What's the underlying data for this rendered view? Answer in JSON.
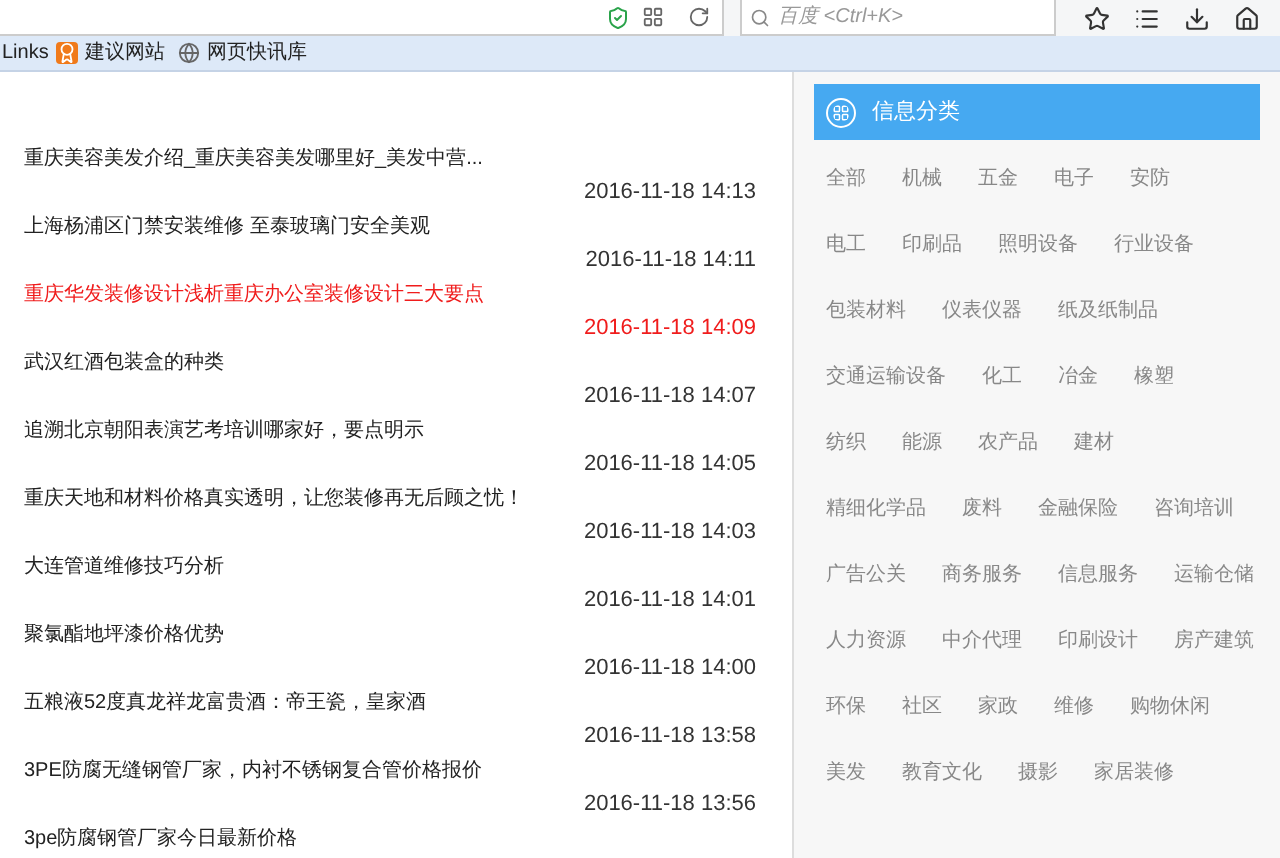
{
  "browser": {
    "search": {
      "placeholder": "百度 <Ctrl+K>"
    }
  },
  "bookmarks": {
    "label": "Links",
    "items": [
      {
        "kind": "site",
        "label": "建议网站"
      },
      {
        "kind": "web",
        "label": "网页快讯库"
      }
    ]
  },
  "articles": [
    {
      "title": "重庆美容美发介绍_重庆美容美发哪里好_美发中营...",
      "date": "2016-11-18 14:13",
      "highlighted": false
    },
    {
      "title": "上海杨浦区门禁安装维修 至泰玻璃门安全美观",
      "date": "2016-11-18 14:11",
      "highlighted": false
    },
    {
      "title": "重庆华发装修设计浅析重庆办公室装修设计三大要点",
      "date": "2016-11-18 14:09",
      "highlighted": true
    },
    {
      "title": "武汉红酒包装盒的种类",
      "date": "2016-11-18 14:07",
      "highlighted": false
    },
    {
      "title": "追溯北京朝阳表演艺考培训哪家好，要点明示",
      "date": "2016-11-18 14:05",
      "highlighted": false
    },
    {
      "title": "重庆天地和材料价格真实透明，让您装修再无后顾之忧！",
      "date": "2016-11-18 14:03",
      "highlighted": false
    },
    {
      "title": "大连管道维修技巧分析",
      "date": "2016-11-18 14:01",
      "highlighted": false
    },
    {
      "title": "聚氯酯地坪漆价格优势",
      "date": "2016-11-18 14:00",
      "highlighted": false
    },
    {
      "title": "五粮液52度真龙祥龙富贵酒：帝王瓷，皇家酒",
      "date": "2016-11-18 13:58",
      "highlighted": false
    },
    {
      "title": "3PE防腐无缝钢管厂家，内衬不锈钢复合管价格报价",
      "date": "2016-11-18 13:56",
      "highlighted": false
    },
    {
      "title": "3pe防腐钢管厂家今日最新价格"
    }
  ],
  "sidebar": {
    "title": "信息分类",
    "tag_rows": [
      [
        "全部",
        "机械",
        "五金",
        "电子",
        "安防"
      ],
      [
        "电工",
        "印刷品",
        "照明设备",
        "行业设备"
      ],
      [
        "包装材料",
        "仪表仪器",
        "纸及纸制品"
      ],
      [
        "交通运输设备",
        "化工",
        "冶金",
        "橡塑"
      ],
      [
        "纺织",
        "能源",
        "农产品",
        "建材"
      ],
      [
        "精细化学品",
        "废料",
        "金融保险",
        "咨询培训"
      ],
      [
        "广告公关",
        "商务服务",
        "信息服务",
        "运输仓储"
      ],
      [
        "人力资源",
        "中介代理",
        "印刷设计",
        "房产建筑"
      ],
      [
        "环保",
        "社区",
        "家政",
        "维修",
        "购物休闲"
      ],
      [
        "美发",
        "教育文化",
        "摄影",
        "家居装修"
      ]
    ]
  }
}
